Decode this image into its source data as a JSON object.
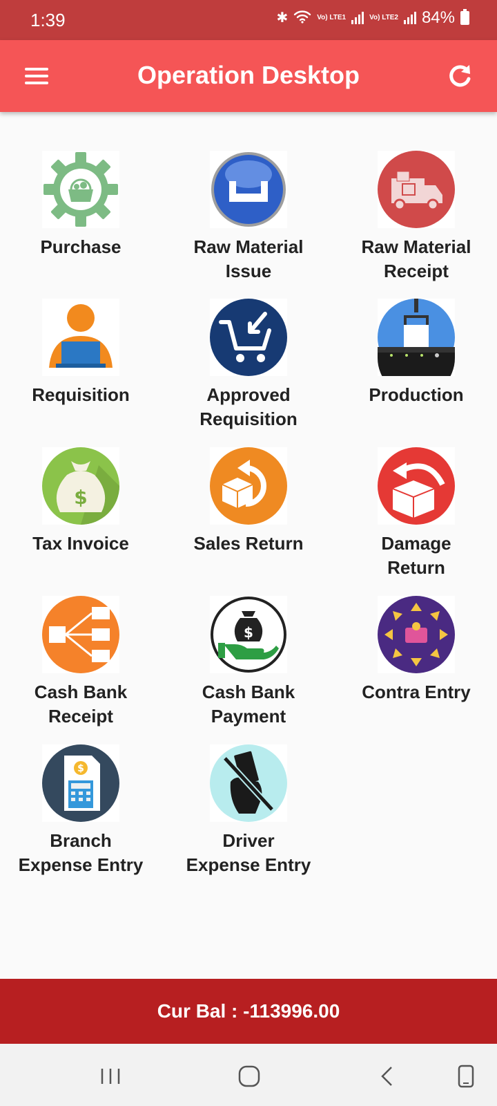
{
  "status": {
    "time": "1:39",
    "battery": "84%",
    "sim1": "Vo) LTE1",
    "sim2": "Vo) LTE2"
  },
  "header": {
    "title": "Operation Desktop"
  },
  "tiles": [
    {
      "label": "Purchase",
      "icon": "purchase-gear-basket-icon"
    },
    {
      "label": "Raw Material\nIssue",
      "icon": "tray-icon"
    },
    {
      "label": "Raw Material\nReceipt",
      "icon": "delivery-truck-icon"
    },
    {
      "label": "Requisition",
      "icon": "person-laptop-icon"
    },
    {
      "label": "Approved\nRequisition",
      "icon": "cart-check-icon"
    },
    {
      "label": "Production",
      "icon": "conveyor-icon"
    },
    {
      "label": "Tax Invoice",
      "icon": "money-bag-icon"
    },
    {
      "label": "Sales Return",
      "icon": "box-return-icon"
    },
    {
      "label": "Damage\nReturn",
      "icon": "damage-box-return-icon"
    },
    {
      "label": "Cash Bank\nReceipt",
      "icon": "flow-split-icon"
    },
    {
      "label": "Cash Bank\nPayment",
      "icon": "hand-money-bag-icon"
    },
    {
      "label": "Contra Entry",
      "icon": "wallet-arrows-icon"
    },
    {
      "label": "Branch\nExpense Entry",
      "icon": "calculator-document-icon"
    },
    {
      "label": "Driver\nExpense Entry",
      "icon": "no-cash-hand-icon"
    }
  ],
  "footer": {
    "balance": "Cur Bal : -113996.00"
  },
  "colors": {
    "status_bar": "#bf3d3d",
    "app_bar": "#f55556",
    "footer": "#b71f21"
  }
}
